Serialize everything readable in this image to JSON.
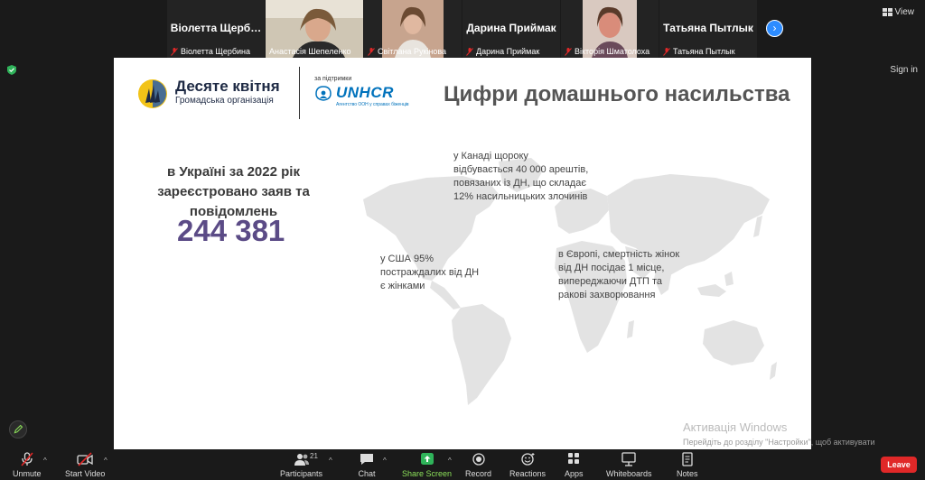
{
  "participants": [
    {
      "display": "Віолетта Щерб…",
      "caption": "Віолетта Щербина",
      "video": false
    },
    {
      "display": "",
      "caption": "Анастасія Шепеленко",
      "video": true,
      "active": true
    },
    {
      "display": "",
      "caption": "Світлана Рукінова",
      "video": true
    },
    {
      "display": "Дарина Приймак",
      "caption": "Дарина Приймак",
      "video": false
    },
    {
      "display": "",
      "caption": "Вікторія Шматолоха",
      "video": true
    },
    {
      "display": "Татьяна Пытлык",
      "caption": "Татьяна Пытлык",
      "video": false
    }
  ],
  "topbar": {
    "view_label": "View",
    "signin_label": "Sign in"
  },
  "slide": {
    "org_name": "Десяте квітня",
    "org_subtitle": "Громадська організація",
    "support_label": "за підтримки",
    "unhcr_name": "UNHCR",
    "unhcr_subtitle": "Агентство ООН у справах біженців",
    "title": "Цифри домашнього насильства",
    "ua_text": "в Україні за 2022 рік зареєстровано заяв та повідомлень",
    "ua_number": "244 381",
    "canada_note": "у Канаді щороку відбувається 40 000 арештів, повязаних із ДН, що складає 12% насильницьких злочинів",
    "usa_note": "у США 95% постраждалих від ДН є жінками",
    "europe_note": "в Європі, смертність жінок від ДН посідає 1 місце, випереджаючи ДТП та ракові захворювання"
  },
  "watermark": {
    "title": "Активація Windows",
    "subtitle": "Перейдіть до розділу \"Настройки\", щоб активувати Windows."
  },
  "toolbar": {
    "unmute": "Unmute",
    "start_video": "Start Video",
    "participants": "Participants",
    "participants_count": "21",
    "chat": "Chat",
    "share_screen": "Share Screen",
    "record": "Record",
    "reactions": "Reactions",
    "apps": "Apps",
    "whiteboards": "Whiteboards",
    "notes": "Notes",
    "leave": "Leave"
  },
  "colors": {
    "accent_number": "#5b4b86",
    "unhcr_blue": "#0072bc",
    "share_green": "#8ce05a",
    "leave_red": "#e02828"
  }
}
